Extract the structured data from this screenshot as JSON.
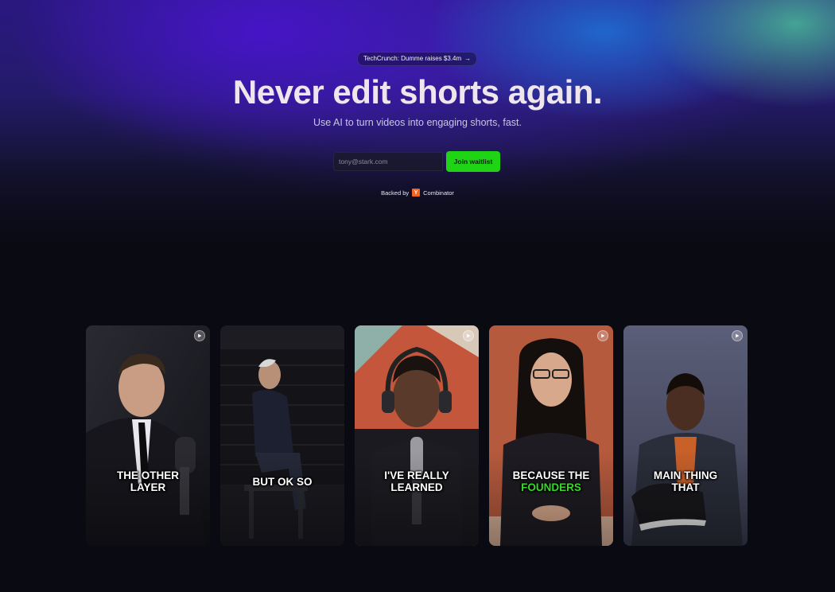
{
  "hero": {
    "news_pill": {
      "label": "TechCrunch: Dumme raises $3.4m",
      "arrow": "→"
    },
    "headline": "Never edit shorts again.",
    "subheadline": "Use AI to turn videos into engaging shorts, fast.",
    "email_placeholder": "tony@stark.com",
    "join_button": "Join waitlist",
    "backed_by": "Backed by",
    "yc_letter": "Y",
    "yc_name": "Combinator"
  },
  "colors": {
    "accent_green": "#1ed415",
    "caption_highlight": "#36d82a",
    "yc_orange": "#f26522"
  },
  "cards": [
    {
      "caption_line1": "THE OTHER",
      "caption_line2": "LAYER",
      "icon": "play-icon"
    },
    {
      "caption_line1": "BUT OK SO",
      "icon": "play-icon"
    },
    {
      "caption_line1": "I'VE REALLY",
      "caption_line2": "LEARNED",
      "icon": "play-icon"
    },
    {
      "caption_line1": "BECAUSE THE",
      "caption_line2": "FOUNDERS",
      "icon": "play-icon"
    },
    {
      "caption_line1": "MAIN THING",
      "caption_line2": "THAT",
      "icon": "play-icon"
    }
  ]
}
